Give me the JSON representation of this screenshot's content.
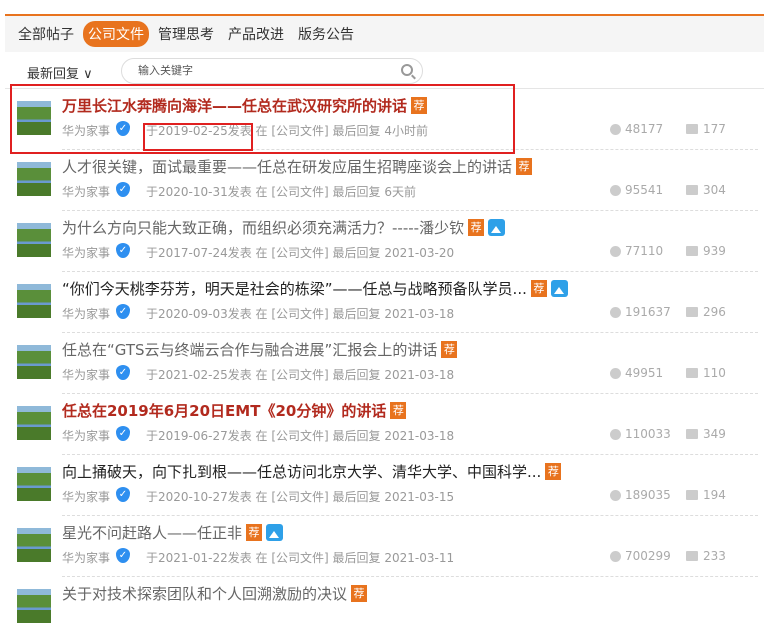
{
  "nav": {
    "tabs": [
      "全部帖子",
      "公司文件",
      "管理思考",
      "产品改进",
      "版务公告"
    ],
    "active": 1
  },
  "sort": {
    "label": "最新回复"
  },
  "search": {
    "placeholder": "输入关键字"
  },
  "colors": {
    "accent": "#e8731e",
    "hot_title": "#b22a1e",
    "annotation": "#e02020"
  },
  "badge_label": "荐",
  "posts": [
    {
      "title": "万里长江水奔腾向海洋——任总在武汉研究所的讲话",
      "style": "red",
      "image": false,
      "author": "华为家事",
      "meta": "于2019-02-25发表 在 [公司文件] 最后回复 4小时前",
      "views": "48177",
      "replies": "177"
    },
    {
      "title": "人才很关键，面试最重要——任总在研发应届生招聘座谈会上的讲话",
      "style": "gray",
      "image": false,
      "author": "华为家事",
      "meta": "于2020-10-31发表 在 [公司文件] 最后回复 6天前",
      "views": "95541",
      "replies": "304"
    },
    {
      "title": "为什么方向只能大致正确，而组织必须充满活力？-----潘少钦",
      "style": "gray",
      "image": true,
      "author": "华为家事",
      "meta": "于2017-07-24发表 在 [公司文件] 最后回复 2021-03-20",
      "views": "77110",
      "replies": "939"
    },
    {
      "title": "“你们今天桃李芬芳，明天是社会的栋梁”——任总与战略预备队学员...",
      "style": "dark",
      "image": true,
      "author": "华为家事",
      "meta": "于2020-09-03发表 在 [公司文件] 最后回复 2021-03-18",
      "views": "191637",
      "replies": "296"
    },
    {
      "title": "任总在“GTS云与终端云合作与融合进展”汇报会上的讲话",
      "style": "gray",
      "image": false,
      "author": "华为家事",
      "meta": "于2021-02-25发表 在 [公司文件] 最后回复 2021-03-18",
      "views": "49951",
      "replies": "110"
    },
    {
      "title": "任总在2019年6月20日EMT《20分钟》的讲话",
      "style": "red",
      "image": false,
      "author": "华为家事",
      "meta": "于2019-06-27发表 在 [公司文件] 最后回复 2021-03-18",
      "views": "110033",
      "replies": "349"
    },
    {
      "title": "向上捅破天，向下扎到根——任总访问北京大学、清华大学、中国科学...",
      "style": "dark",
      "image": false,
      "author": "华为家事",
      "meta": "于2020-10-27发表 在 [公司文件] 最后回复 2021-03-15",
      "views": "189035",
      "replies": "194"
    },
    {
      "title": "星光不问赶路人——任正非",
      "style": "gray",
      "image": true,
      "author": "华为家事",
      "meta": "于2021-01-22发表 在 [公司文件] 最后回复 2021-03-11",
      "views": "700299",
      "replies": "233"
    },
    {
      "title": "关于对技术探索团队和个人回溯激励的决议",
      "style": "gray",
      "image": false,
      "author": "",
      "meta": "",
      "views": "",
      "replies": ""
    }
  ]
}
